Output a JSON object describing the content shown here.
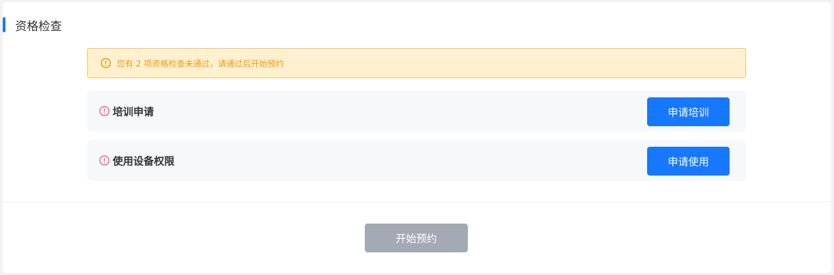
{
  "section": {
    "title": "资格检查"
  },
  "warning": {
    "icon": "warning-circle-icon",
    "text": "您有 2 项资格检查未通过，请通过后开始预约"
  },
  "checks": [
    {
      "icon": "error-circle-icon",
      "label": "培训申请",
      "button_label": "申请培训"
    },
    {
      "icon": "error-circle-icon",
      "label": "使用设备权限",
      "button_label": "申请使用"
    }
  ],
  "footer": {
    "start_button_label": "开始预约"
  },
  "colors": {
    "accent": "#1677ff",
    "warning_bg": "#fff1cf",
    "warning_border": "#f5c15f",
    "warning_text": "#f09a16",
    "error_icon": "#f0708e",
    "disabled_button": "#a3a9b5"
  }
}
